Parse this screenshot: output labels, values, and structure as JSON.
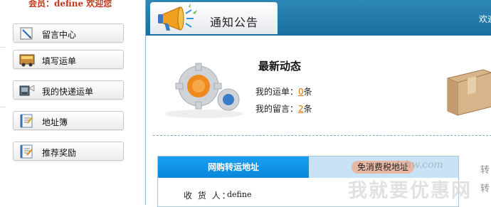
{
  "sidebar": {
    "welcome": "会员：define 欢迎您",
    "items": [
      {
        "label": "留言中心",
        "icon": "pen-icon"
      },
      {
        "label": "填写运单",
        "icon": "truck-icon"
      },
      {
        "label": "我的快递运单",
        "icon": "scanner-icon"
      },
      {
        "label": "地址簿",
        "icon": "address-book-icon"
      },
      {
        "label": "推荐奖励",
        "icon": "notepad-icon"
      }
    ]
  },
  "header": {
    "tab_title": "通知公告",
    "top_welcome": "欢迎"
  },
  "news": {
    "title": "最新动态",
    "waybill_label": "我的运单：",
    "waybill_count": "0",
    "waybill_unit": "条",
    "message_label": "我的留言：",
    "message_count": "2",
    "message_unit": "条"
  },
  "address": {
    "tab_active": "网购转运地址",
    "tab_second": "免消费税地址",
    "receiver_label": "收 货 人：",
    "receiver_value": "define"
  },
  "watermark": {
    "url": "lyhw.com",
    "text": "我就要优惠网"
  },
  "edge_chars": [
    "转",
    "转"
  ],
  "colors": {
    "header_blue": "#1f78a8",
    "active_tab_blue": "#0a8ee0",
    "welcome_red": "#c4361b",
    "count_orange": "#e07000"
  }
}
